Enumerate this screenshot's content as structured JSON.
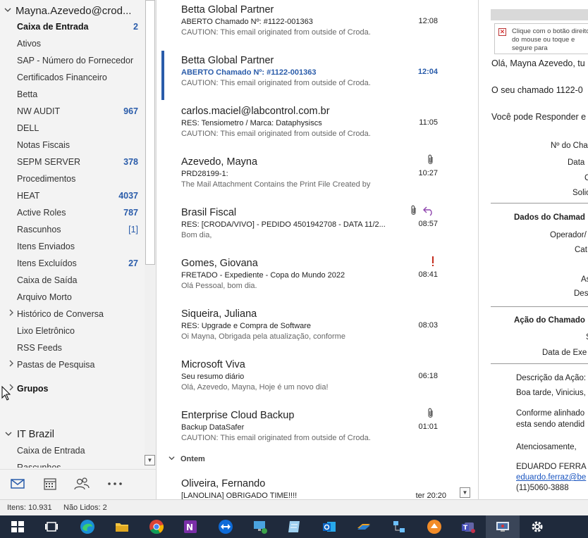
{
  "folder_pane": {
    "account_name": "Mayna.Azevedo@crod...",
    "folders": [
      {
        "label": "Caixa de Entrada",
        "count": "2",
        "bold": true
      },
      {
        "label": "Ativos",
        "count": ""
      },
      {
        "label": "SAP - Número do Fornecedor",
        "count": ""
      },
      {
        "label": "Certificados Financeiro",
        "count": ""
      },
      {
        "label": "Betta",
        "count": ""
      },
      {
        "label": "NW AUDIT",
        "count": "967"
      },
      {
        "label": "DELL",
        "count": ""
      },
      {
        "label": "Notas Fiscais",
        "count": ""
      },
      {
        "label": "SEPM SERVER",
        "count": "378"
      },
      {
        "label": "Procedimentos",
        "count": ""
      },
      {
        "label": "HEAT",
        "count": "4037"
      },
      {
        "label": "Active Roles",
        "count": "787"
      },
      {
        "label": "Rascunhos",
        "count": "[1]"
      },
      {
        "label": "Itens Enviados",
        "count": ""
      },
      {
        "label": "Itens Excluídos",
        "count": "27"
      },
      {
        "label": "Caixa de Saída",
        "count": ""
      },
      {
        "label": "Arquivo Morto",
        "count": ""
      },
      {
        "label": "Histórico de Conversa",
        "count": ""
      },
      {
        "label": "Lixo Eletrônico",
        "count": ""
      },
      {
        "label": "RSS Feeds",
        "count": ""
      },
      {
        "label": "Pastas de Pesquisa",
        "count": ""
      }
    ],
    "groups_label": "Grupos",
    "second_account": "IT Brazil",
    "second_folders": [
      "Caixa de Entrada",
      "Rascunhos"
    ]
  },
  "messages": [
    {
      "sender": "Betta Global Partner",
      "subject": "ABERTO Chamado Nº: #1122-001363",
      "preview": "CAUTION: This email originated from outside of Croda.",
      "time": "12:08"
    },
    {
      "sender": "Betta Global Partner",
      "subject": "ABERTO Chamado Nº: #1122-001363",
      "preview": "CAUTION: This email originated from outside of Croda.",
      "time": "12:04",
      "selected": true
    },
    {
      "sender": "carlos.maciel@labcontrol.com.br",
      "subject": "RES: Tensiometro / Marca: Dataphysiscs",
      "preview": "CAUTION: This email originated from outside of Croda.",
      "time": "11:05"
    },
    {
      "sender": "Azevedo, Mayna",
      "subject": "PRD28199-1:",
      "preview": "The Mail Attachment Contains the Print File Created by",
      "time": "10:27",
      "icons": [
        "paperclip-icon"
      ]
    },
    {
      "sender": "Brasil Fiscal",
      "subject": "RES: [CRODA/VIVO] - PEDIDO 4501942708 - DATA 11/2...",
      "preview": "Bom dia,",
      "time": "08:57",
      "icons": [
        "paperclip-icon",
        "reply-icon"
      ]
    },
    {
      "sender": "Gomes, Giovana",
      "subject": "FRETADO - Expediente - Copa do Mundo 2022",
      "preview": "Olá Pessoal, bom dia.",
      "time": "08:41",
      "icons": [
        "importance-icon"
      ]
    },
    {
      "sender": "Siqueira, Juliana",
      "subject": "RES: Upgrade e Compra de Software",
      "preview": "Oi Mayna,  Obrigada pela atualização, conforme",
      "time": "08:03"
    },
    {
      "sender": "Microsoft Viva",
      "subject": "Seu resumo diário",
      "preview": "Olá, Azevedo, Mayna,   Hoje é um novo dia!",
      "time": "06:18"
    },
    {
      "sender": "Enterprise Cloud Backup",
      "subject": "Backup DataSafer",
      "preview": "CAUTION: This email originated from outside of Croda.",
      "time": "01:01",
      "icons": [
        "paperclip-icon"
      ]
    }
  ],
  "group_header": "Ontem",
  "last_message": {
    "sender": "Oliveira, Fernando",
    "subject": "[LANOLINA] OBRIGADO TIME!!!!",
    "time": "ter 20:20"
  },
  "reading_pane": {
    "image_placeholder": "Clique com o botão direito do mouse ou toque e segure para",
    "greeting": "Olá, Mayna Azevedo, tu",
    "line2": "O seu chamado 1122-0",
    "line3": "Você pode Responder e",
    "fields": [
      "Nº do Cha",
      "Data",
      "C",
      "Solic"
    ],
    "section1": "Dados do Chamad",
    "fields2": [
      "Operador/",
      "Cat",
      "As",
      "Des"
    ],
    "section2": "Ação do Chamado",
    "fields3": [
      "S",
      "Data de Exe"
    ],
    "desc_label": "Descrição da Ação:",
    "desc1": "Boa tarde, Vinicius,",
    "desc2": "Conforme alinhado",
    "desc3": "esta sendo atendid",
    "closing": "Atenciosamente,",
    "signer": "EDUARDO FERRA",
    "email": "eduardo.ferraz@be",
    "phone": "(11)5060-3888"
  },
  "status_bar": {
    "items": "Itens: 10.931",
    "unread": "Não Lidos: 2"
  },
  "colors": {
    "accent": "#2a5caa",
    "taskbar": "#1f2a3c"
  }
}
